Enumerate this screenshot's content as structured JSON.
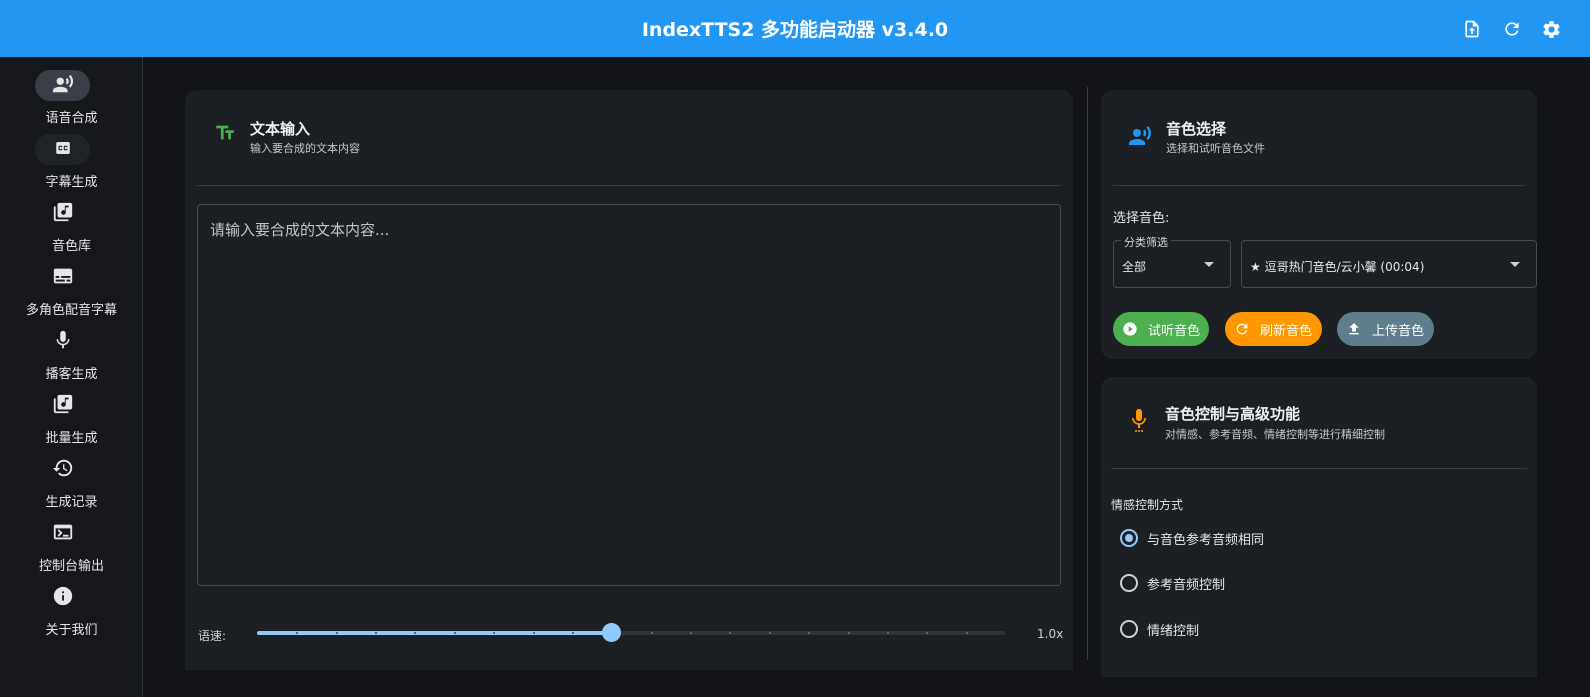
{
  "app": {
    "title": "IndexTTS2 多功能启动器 v3.4.0"
  },
  "toolbar": {
    "icons": [
      "upload-file-icon",
      "refresh-icon",
      "gear-icon"
    ]
  },
  "sidebar": {
    "items": [
      {
        "label": "语音合成",
        "icon": "record-voice-icon",
        "active": true
      },
      {
        "label": "字幕生成",
        "icon": "closed-caption-icon"
      },
      {
        "label": "音色库",
        "icon": "library-music-icon"
      },
      {
        "label": "多角色配音字幕",
        "icon": "subtitles-icon"
      },
      {
        "label": "播客生成",
        "icon": "microphone-icon"
      },
      {
        "label": "批量生成",
        "icon": "library-music-icon"
      },
      {
        "label": "生成记录",
        "icon": "history-icon"
      },
      {
        "label": "控制台输出",
        "icon": "terminal-icon"
      },
      {
        "label": "关于我们",
        "icon": "info-icon"
      }
    ]
  },
  "text_card": {
    "icon": "text-fields-icon",
    "title": "文本输入",
    "subtitle": "输入要合成的文本内容",
    "placeholder": "请输入要合成的文本内容...",
    "value": "",
    "speed_label": "语速:",
    "speed_value": "1.0x",
    "speed_min": 0.1,
    "speed_max": 2.0,
    "speed_current": 1.0,
    "accent": "#4caf50"
  },
  "voice_card": {
    "icon": "record-voice-icon",
    "title": "音色选择",
    "subtitle": "选择和试听音色文件",
    "select_label": "选择音色:",
    "filter_legend": "分类筛选",
    "filter_value": "全部",
    "voice_value": "★ 逗哥热门音色/云小馨 (00:04)",
    "buttons": {
      "preview": "试听音色",
      "refresh": "刷新音色",
      "upload": "上传音色"
    },
    "colors": {
      "preview": "#4caf50",
      "refresh": "#ff9800",
      "upload": "#607d8b",
      "icon": "#2196f3"
    }
  },
  "control_card": {
    "icon": "microphone-icon",
    "title": "音色控制与高级功能",
    "subtitle": "对情感、参考音频、情绪控制等进行精细控制",
    "emotion_label": "情感控制方式",
    "options": [
      {
        "label": "与音色参考音频相同",
        "checked": true
      },
      {
        "label": "参考音频控制",
        "checked": false
      },
      {
        "label": "情绪控制",
        "checked": false
      }
    ],
    "icon_color": "#ff9800"
  }
}
